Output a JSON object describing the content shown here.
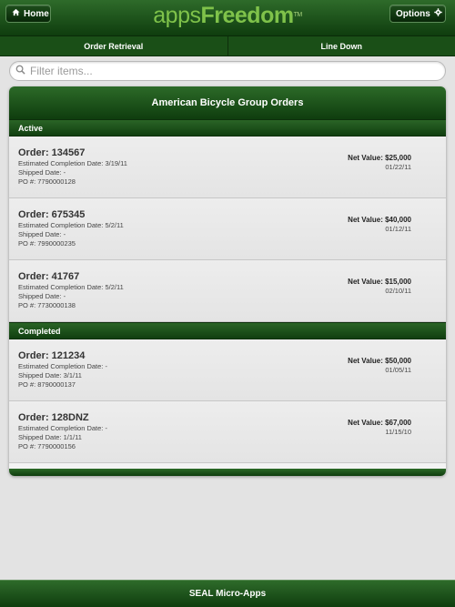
{
  "header": {
    "home_label": "Home",
    "options_label": "Options",
    "logo_apps": "apps",
    "logo_freedom": "Freedom",
    "logo_tm": "TM"
  },
  "tabs": [
    {
      "label": "Order Retrieval"
    },
    {
      "label": "Line Down"
    }
  ],
  "search": {
    "placeholder": "Filter items..."
  },
  "panel": {
    "title": "American Bicycle Group Orders",
    "sections": [
      {
        "label": "Active",
        "orders": [
          {
            "title": "Order: 134567",
            "ecd": "Estimated Completion Date: 3/19/11",
            "shipped": "Shipped Date: -",
            "po": "PO #: 7790000128",
            "net": "Net Value: $25,000",
            "date": "01/22/11"
          },
          {
            "title": "Order: 675345",
            "ecd": "Estimated Completion Date: 5/2/11",
            "shipped": "Shipped Date: -",
            "po": "PO #: 7990000235",
            "net": "Net Value: $40,000",
            "date": "01/12/11"
          },
          {
            "title": "Order: 41767",
            "ecd": "Estimated Completion Date: 5/2/11",
            "shipped": "Shipped Date: -",
            "po": "PO #: 7730000138",
            "net": "Net Value: $15,000",
            "date": "02/10/11"
          }
        ]
      },
      {
        "label": "Completed",
        "orders": [
          {
            "title": "Order: 121234",
            "ecd": "Estimated Completion Date: -",
            "shipped": "Shipped Date: 3/1/11",
            "po": "PO #: 8790000137",
            "net": "Net Value: $50,000",
            "date": "01/05/11"
          },
          {
            "title": "Order: 128DNZ",
            "ecd": "Estimated Completion Date: -",
            "shipped": "Shipped Date: 1/1/11",
            "po": "PO #: 7790000156",
            "net": "Net Value: $67,000",
            "date": "11/15/10"
          }
        ]
      }
    ]
  },
  "footer": {
    "label": "SEAL Micro-Apps"
  },
  "icons": {
    "home": "home-icon",
    "options": "gear-icon",
    "search": "search-icon"
  },
  "colors": {
    "brand_green": "#1a4f17",
    "logo_green": "#7fc24a",
    "background": "#e3e3e3"
  }
}
